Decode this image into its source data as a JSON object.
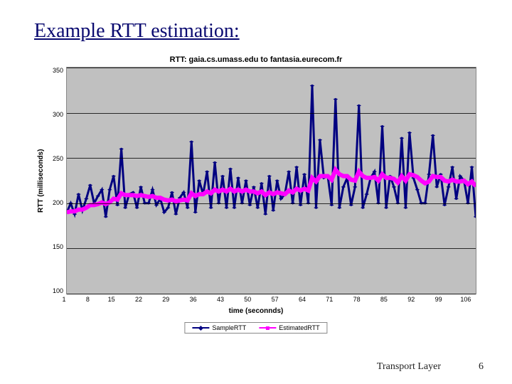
{
  "title": "Example RTT estimation:",
  "footer": {
    "label": "Transport Layer",
    "page": "6"
  },
  "chart_data": {
    "type": "line",
    "title": "RTT: gaia.cs.umass.edu to fantasia.eurecom.fr",
    "xlabel": "time (seconnds)",
    "ylabel": "RTT (milliseconds)",
    "ylim": [
      100,
      350
    ],
    "x": [
      1,
      2,
      3,
      4,
      5,
      6,
      7,
      8,
      9,
      10,
      11,
      12,
      13,
      14,
      15,
      16,
      17,
      18,
      19,
      20,
      21,
      22,
      23,
      24,
      25,
      26,
      27,
      28,
      29,
      30,
      31,
      32,
      33,
      34,
      35,
      36,
      37,
      38,
      39,
      40,
      41,
      42,
      43,
      44,
      45,
      46,
      47,
      48,
      49,
      50,
      51,
      52,
      53,
      54,
      55,
      56,
      57,
      58,
      59,
      60,
      61,
      62,
      63,
      64,
      65,
      66,
      67,
      68,
      69,
      70,
      71,
      72,
      73,
      74,
      75,
      76,
      77,
      78,
      79,
      80,
      81,
      82,
      83,
      84,
      85,
      86,
      87,
      88,
      89,
      90,
      91,
      92,
      93,
      94,
      95,
      96,
      97,
      98,
      99,
      100,
      101,
      102,
      103,
      104,
      105,
      106
    ],
    "x_ticks": [
      1,
      8,
      15,
      22,
      29,
      36,
      43,
      50,
      57,
      64,
      71,
      78,
      85,
      92,
      99,
      106
    ],
    "series": [
      {
        "name": "SampleRTT",
        "color": "#000080",
        "marker": "diamond",
        "values": [
          190,
          200,
          188,
          210,
          192,
          205,
          220,
          200,
          208,
          215,
          185,
          215,
          230,
          198,
          260,
          195,
          210,
          212,
          195,
          218,
          200,
          200,
          215,
          198,
          205,
          190,
          195,
          212,
          188,
          206,
          212,
          195,
          268,
          190,
          225,
          210,
          235,
          195,
          245,
          200,
          230,
          195,
          238,
          195,
          228,
          200,
          225,
          198,
          218,
          195,
          222,
          188,
          230,
          192,
          225,
          205,
          210,
          235,
          200,
          240,
          198,
          232,
          200,
          330,
          195,
          270,
          228,
          230,
          198,
          315,
          195,
          218,
          228,
          198,
          218,
          308,
          195,
          210,
          228,
          235,
          200,
          285,
          195,
          230,
          218,
          200,
          272,
          195,
          278,
          228,
          215,
          200,
          200,
          232,
          275,
          218,
          232,
          198,
          218,
          240,
          205,
          230,
          225,
          200,
          240,
          185
        ]
      },
      {
        "name": "EstimatedRTT",
        "color": "#ff00ff",
        "marker": "square",
        "values": [
          190,
          191,
          191,
          193,
          193,
          195,
          198,
          198,
          199,
          201,
          199,
          201,
          205,
          204,
          211,
          209,
          209,
          209,
          208,
          209,
          208,
          207,
          208,
          206,
          206,
          204,
          203,
          204,
          202,
          203,
          204,
          203,
          211,
          208,
          210,
          210,
          213,
          211,
          215,
          213,
          215,
          213,
          216,
          213,
          215,
          213,
          215,
          213,
          213,
          211,
          213,
          209,
          212,
          210,
          212,
          211,
          210,
          214,
          212,
          216,
          214,
          216,
          214,
          228,
          224,
          230,
          230,
          230,
          226,
          237,
          232,
          230,
          230,
          226,
          225,
          235,
          230,
          228,
          228,
          229,
          225,
          232,
          228,
          228,
          227,
          223,
          230,
          225,
          232,
          231,
          229,
          225,
          222,
          224,
          230,
          229,
          229,
          225,
          224,
          226,
          224,
          224,
          225,
          221,
          224,
          219
        ]
      }
    ]
  }
}
